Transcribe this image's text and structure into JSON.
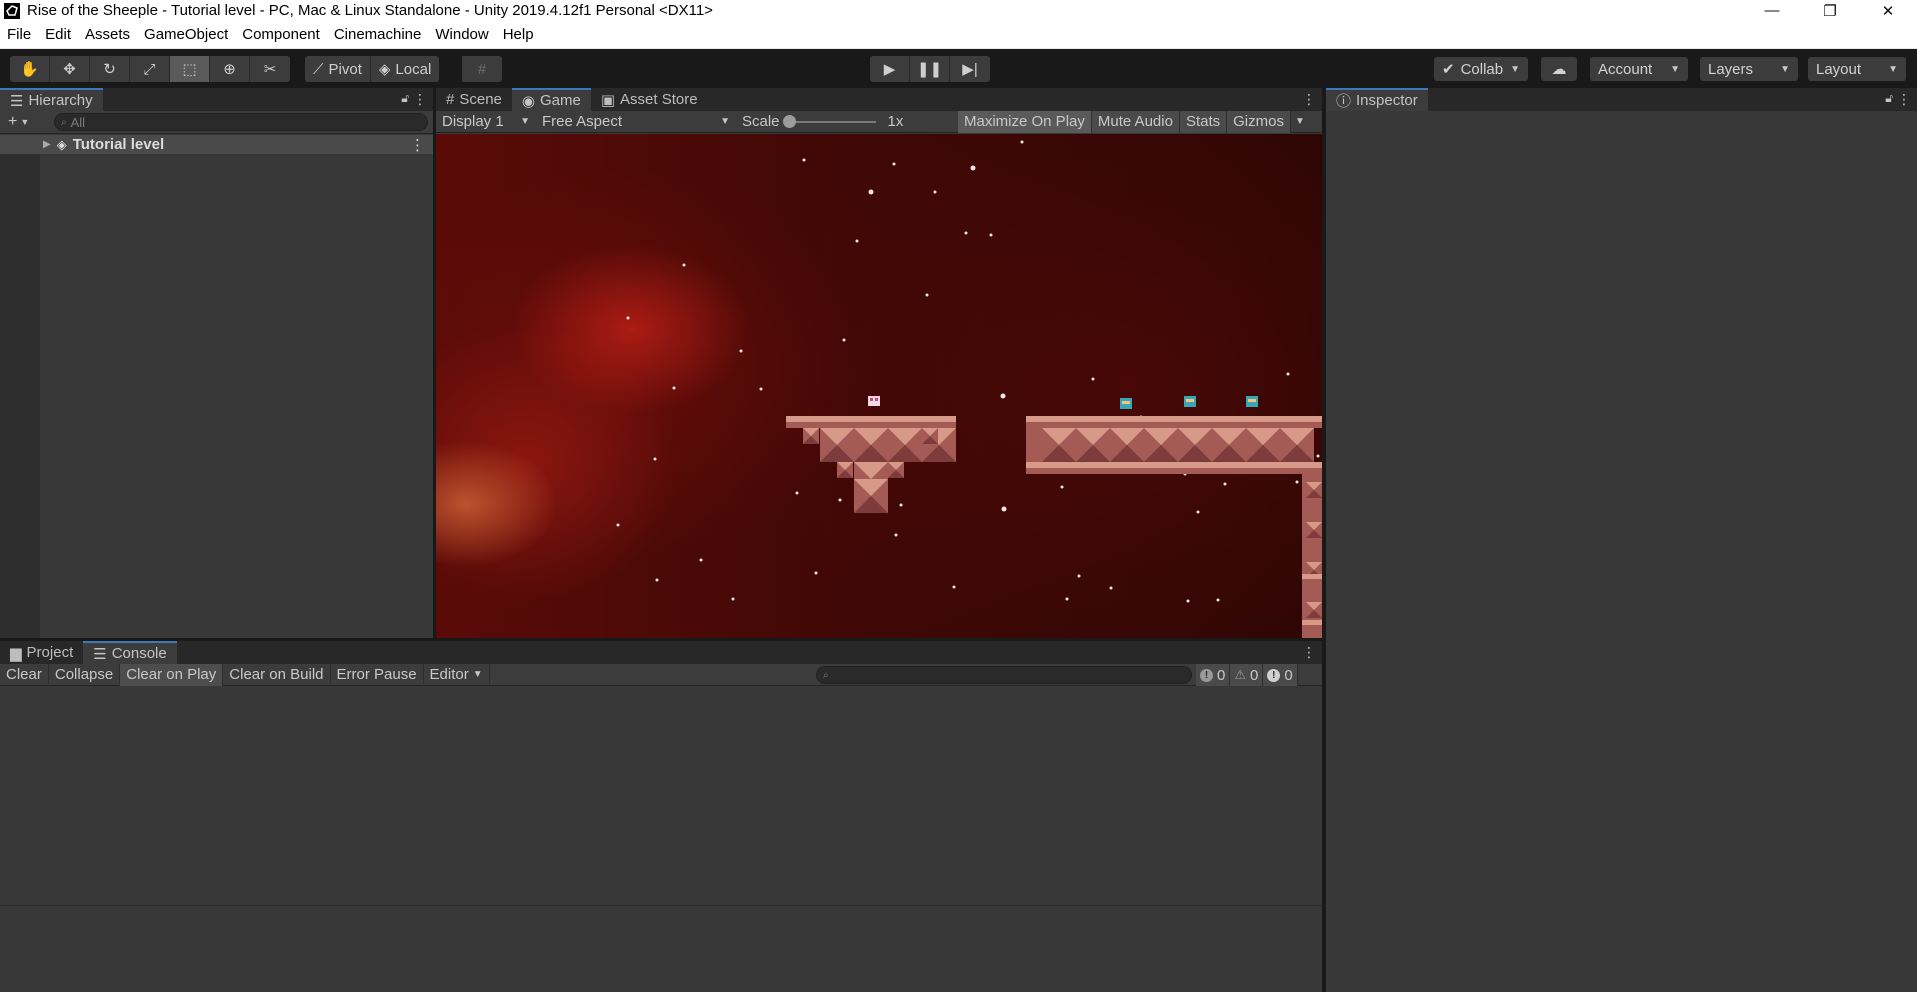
{
  "window": {
    "title": "Rise of the Sheeple - Tutorial level - PC, Mac & Linux Standalone - Unity 2019.4.12f1 Personal <DX11>",
    "minimize_icon": "minimize-icon",
    "restore_icon": "restore-icon",
    "close_icon": "close-icon"
  },
  "menu": [
    "File",
    "Edit",
    "Assets",
    "GameObject",
    "Component",
    "Cinemachine",
    "Window",
    "Help"
  ],
  "toolbar": {
    "tools": [
      "hand-tool-icon",
      "move-tool-icon",
      "rotate-tool-icon",
      "scale-tool-icon",
      "rect-tool-icon",
      "transform-tool-icon",
      "custom-tool-icon"
    ],
    "active_tool": "rect-tool-icon",
    "pivot_label": "Pivot",
    "local_label": "Local",
    "collab_label": "Collab",
    "account_label": "Account",
    "layers_label": "Layers",
    "layout_label": "Layout"
  },
  "hierarchy": {
    "tab_label": "Hierarchy",
    "search_placeholder": "All",
    "scene_name": "Tutorial level"
  },
  "game_panel": {
    "tabs": [
      {
        "label": "Scene",
        "active": false
      },
      {
        "label": "Game",
        "active": true
      },
      {
        "label": "Asset Store",
        "active": false
      }
    ],
    "display_label": "Display 1",
    "aspect_label": "Free Aspect",
    "scale_label": "Scale",
    "scale_value": "1x",
    "scale_fraction": 0.0,
    "maximize_label": "Maximize On Play",
    "mute_label": "Mute Audio",
    "stats_label": "Stats",
    "gizmos_label": "Gizmos"
  },
  "inspector": {
    "tab_label": "Inspector"
  },
  "bottom_panel": {
    "tabs": [
      {
        "label": "Project",
        "active": false
      },
      {
        "label": "Console",
        "active": true
      }
    ],
    "buttons": {
      "clear": "Clear",
      "collapse": "Collapse",
      "clear_on_play": "Clear on Play",
      "clear_on_build": "Clear on Build",
      "error_pause": "Error Pause",
      "editor": "Editor"
    },
    "counts": {
      "info": "0",
      "warning": "0",
      "error": "0"
    }
  },
  "colors": {
    "accent": "#3a79bb",
    "panel": "#383838",
    "toolbar": "#191919",
    "tile_light": "#d89a88",
    "tile_dark": "#a45a55"
  }
}
